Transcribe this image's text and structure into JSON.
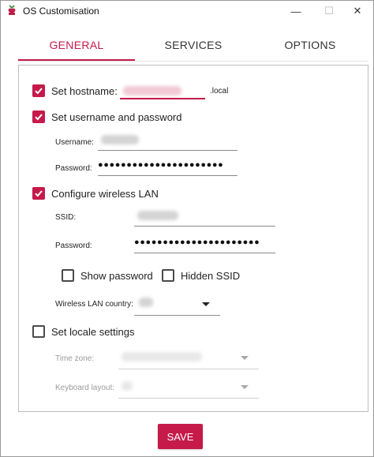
{
  "window": {
    "title": "OS Customisation",
    "minimize_glyph": "—",
    "maximize_glyph": "☐",
    "close_glyph": "✕"
  },
  "tabs": [
    {
      "label": "GENERAL",
      "active": true
    },
    {
      "label": "SERVICES",
      "active": false
    },
    {
      "label": "OPTIONS",
      "active": false
    }
  ],
  "general": {
    "hostname": {
      "label": "Set hostname:",
      "checked": true,
      "suffix": ".local"
    },
    "user": {
      "label": "Set username and password",
      "checked": true,
      "username_label": "Username:",
      "password_label": "Password:",
      "password_mask": "●●●●●●●●●●●●●●●●●●●●●●"
    },
    "wifi": {
      "label": "Configure wireless LAN",
      "checked": true,
      "ssid_label": "SSID:",
      "password_label": "Password:",
      "password_mask": "●●●●●●●●●●●●●●●●●●●●●●",
      "show_password": {
        "label": "Show password",
        "checked": false
      },
      "hidden_ssid": {
        "label": "Hidden SSID",
        "checked": false
      },
      "country_label": "Wireless LAN country:"
    },
    "locale": {
      "label": "Set locale settings",
      "checked": false,
      "timezone_label": "Time zone:",
      "keyboard_label": "Keyboard layout:"
    }
  },
  "footer": {
    "save_label": "SAVE"
  },
  "colors": {
    "accent": "#c51a4a"
  },
  "icons": {
    "app": "raspberry-icon",
    "check": "checkmark-icon",
    "dropdown": "caret-down-icon"
  }
}
